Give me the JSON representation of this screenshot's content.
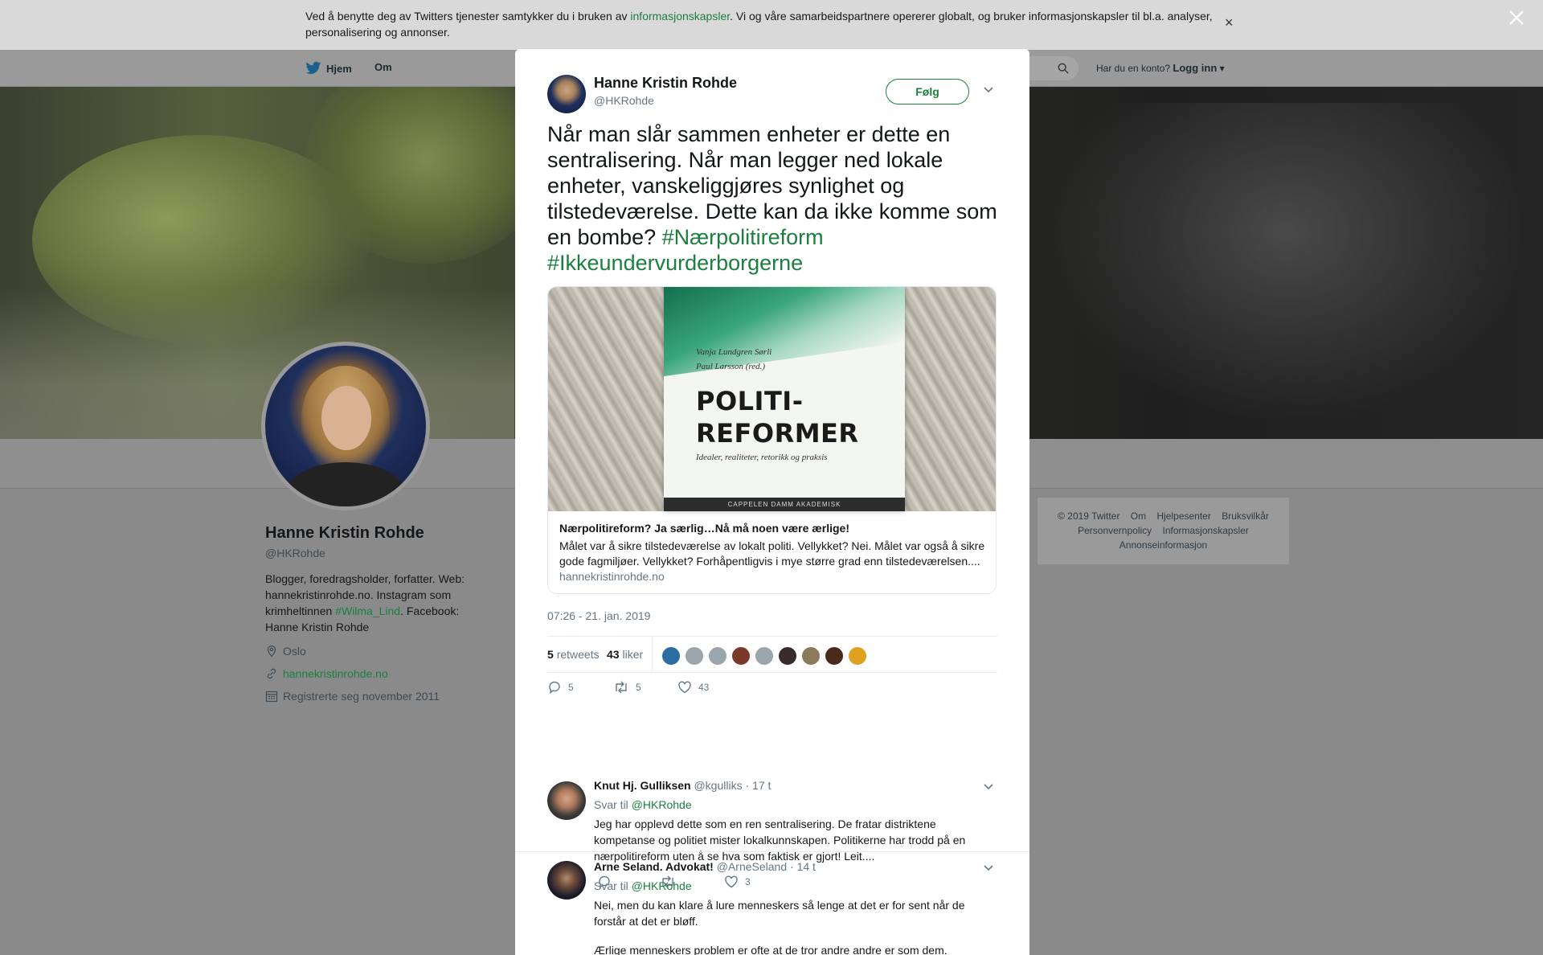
{
  "cookie": {
    "text_before": "Ved å benytte deg av Twitters tjenester samtykker du i bruken av ",
    "link": "informasjonskapsler",
    "text_after": ". Vi og våre samarbeidspartnere opererer globalt, og bruker informasjonskapsler til bl.a. analyser, personalisering og annonser.",
    "close": "×"
  },
  "nav": {
    "home": "Hjem",
    "about": "Om",
    "account_prompt": "Har du en konto?",
    "login": "Logg inn"
  },
  "profile": {
    "name": "Hanne Kristin Rohde",
    "handle": "@HKRohde",
    "bio_before": "Blogger, foredragsholder, forfatter. Web: hannekristinrohde.no. Instagram som krimheltinnen ",
    "bio_tag": "#Wilma_Lind",
    "bio_after": ". Facebook: Hanne Kristin Rohde",
    "location": "Oslo",
    "url": "hannekristinrohde.no",
    "joined": "Registrerte seg november 2011"
  },
  "footer": {
    "links": [
      "© 2019 Twitter",
      "Om",
      "Hjelpesenter",
      "Bruksvilkår",
      "Personvernpolicy",
      "Informasjonskapsler",
      "Annonseinformasjon"
    ]
  },
  "tweet": {
    "name": "Hanne Kristin Rohde",
    "handle": "@HKRohde",
    "follow": "Følg",
    "text": "Når man slår sammen enheter er dette en sentralisering. Når man legger ned lokale enheter, vanskeliggjøres synlighet og tilstedeværelse. Dette kan da ikke komme som en bombe? ",
    "tag1": "#Nærpolitireform",
    "tag2": "#Ikkeundervurderborgerne",
    "card": {
      "book_authors_1": "Vanja Lundgren Sørli",
      "book_authors_2": "Paul Larsson (red.)",
      "book_title_1": "POLITI-",
      "book_title_2": "REFORMER",
      "book_subtitle": "Idealer, realiteter, retorikk og praksis",
      "book_publisher": "CAPPELEN DAMM AKADEMISK",
      "title": "Nærpolitireform? Ja særlig…Nå må noen være ærlige!",
      "description": "Målet var å sikre tilstedeværelse av lokalt politi. Vellykket? Nei. Målet var også å sikre gode fagmiljøer. Vellykket? Forhåpentligvis i mye større grad enn tilstedeværelsen....",
      "domain": "hannekristinrohde.no"
    },
    "time": "07:26 - 21. jan. 2019",
    "retweets_count": "5",
    "retweets_label": "retweets",
    "likes_count": "43",
    "likes_label": "liker",
    "actions": {
      "replies": "5",
      "retweets": "5",
      "likes": "43"
    },
    "liker_colors": [
      "#2b6ca3",
      "#9aa5ad",
      "#9aa5ad",
      "#7a3a2a",
      "#9aa5ad",
      "#3a2a2a",
      "#8a7a5a",
      "#4a2a1a",
      "#e0a020"
    ]
  },
  "replies": [
    {
      "name": "Knut Hj. Gulliksen",
      "handle": "@kgulliks",
      "time": "· 17 t",
      "to_label": "Svar til",
      "to_handle": "@HKRohde",
      "text": "Jeg har opplevd dette som en ren sentralisering. De fratar distriktene kompetanse og politiet mister lokalkunnskapen. Politikerne har trodd på en nærpolitireform uten å se hva som faktisk er gjort! Leit....",
      "likes": "3"
    },
    {
      "name": "Arne Seland. Advokat!",
      "handle": "@ArneSeland",
      "time": "· 14 t",
      "to_label": "Svar til",
      "to_handle": "@HKRohde",
      "text": "Nei, men du kan klare å lure menneskers så lenge at det er for sent når de forstår at det er bløff.",
      "text2": "Ærlige menneskers problem er ofte at de tror andre andre er som dem."
    }
  ]
}
